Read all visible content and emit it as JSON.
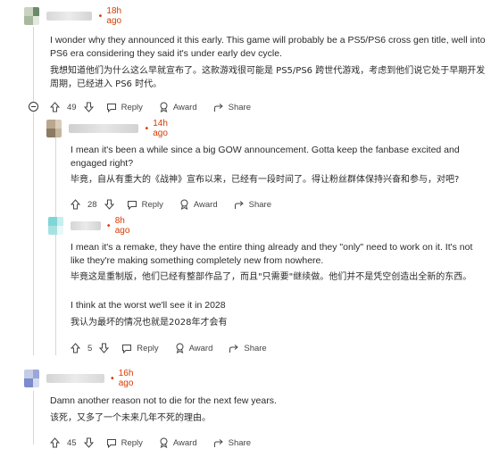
{
  "comments": [
    {
      "time": "18h ago",
      "text_en": "I wonder why they announced it this early. This game will probably be a PS5/PS6 cross gen title, well into PS6 era considering they said it's under early dev cycle.",
      "text_zh": "我想知道他们为什么这么早就宣布了。这款游戏很可能是 PS5/PS6 跨世代游戏，考虑到他们说它处于早期开发周期，已经进入 PS6 时代。",
      "votes": "49",
      "reply_label": "Reply",
      "award_label": "Award",
      "share_label": "Share"
    },
    {
      "time": "14h ago",
      "text_en": "I mean it's been a while since a big GOW announcement. Gotta keep the fanbase excited and engaged right?",
      "text_zh": "毕竟，自从有重大的《战神》宣布以来，已经有一段时间了。得让粉丝群体保持兴奋和参与，对吧?",
      "votes": "28",
      "reply_label": "Reply",
      "award_label": "Award",
      "share_label": "Share"
    },
    {
      "time": "8h ago",
      "text_en": "I mean it's a remake, they have the entire thing already and they \"only\" need to work on it. It's not like they're making something completely new from nowhere.",
      "text_zh": "毕竟这是重制版，他们已经有整部作品了，而且\"只需要\"继续做。他们并不是凭空创造出全新的东西。",
      "text_en2": "I think at the worst we'll see it in 2028",
      "text_zh2": "我认为最坏的情况也就是2028年才会有",
      "votes": "5",
      "reply_label": "Reply",
      "award_label": "Award",
      "share_label": "Share"
    },
    {
      "time": "16h ago",
      "text_en": "Damn another reason not to die for the next few years.",
      "text_zh": "该死，又多了一个未来几年不死的理由。",
      "votes": "45",
      "reply_label": "Reply",
      "award_label": "Award",
      "share_label": "Share"
    }
  ],
  "icons": {
    "upvote": "upvote-icon",
    "downvote": "downvote-icon",
    "reply": "reply-icon",
    "award": "award-icon",
    "share": "share-icon",
    "collapse": "collapse-icon"
  },
  "colors": {
    "timestamp": "#d93a00",
    "text": "#2a2a2a",
    "meta": "#454545",
    "thread_line": "#d6d6d6"
  }
}
